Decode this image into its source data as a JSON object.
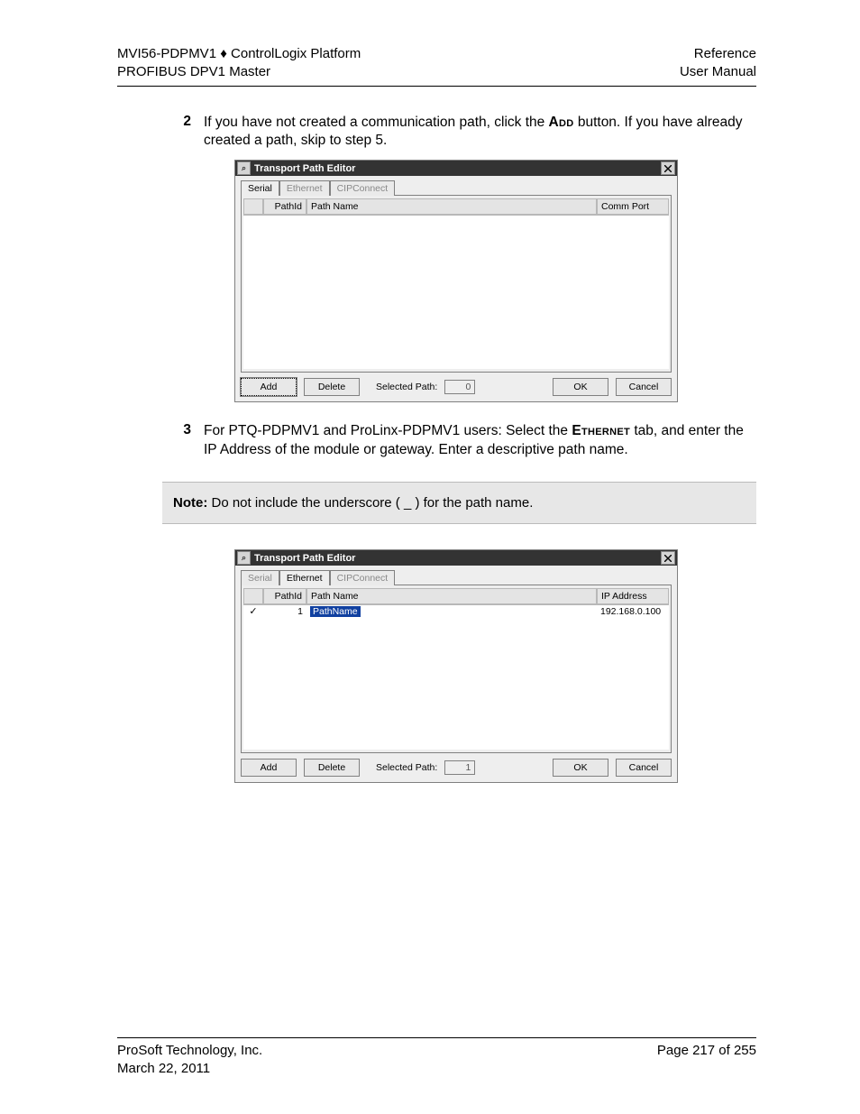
{
  "header": {
    "left_line1": "MVI56-PDPMV1 ♦ ControlLogix Platform",
    "left_line2": "PROFIBUS DPV1 Master",
    "right_line1": "Reference",
    "right_line2": "User Manual"
  },
  "step2": {
    "num": "2",
    "pre": "If you have not created a communication path, click the ",
    "bold": "Add",
    "post": " button. If you have already created a path, skip to step 5."
  },
  "step3": {
    "num": "3",
    "pre": "For PTQ-PDPMV1 and ProLinx-PDPMV1 users: Select the ",
    "bold": "Ethernet",
    "post": " tab, and enter the IP Address of the module or gateway. Enter a descriptive path name."
  },
  "note": {
    "label": "Note:",
    "text": " Do not include the underscore ( _ ) for the path name."
  },
  "dialog1": {
    "title": "Transport Path Editor",
    "tabs": {
      "serial": "Serial",
      "ethernet": "Ethernet",
      "cip": "CIPConnect"
    },
    "active_tab": "serial",
    "columns": {
      "chk": "",
      "id": "PathId",
      "name": "Path Name",
      "port": "Comm Port"
    },
    "rows": [],
    "footer": {
      "add": "Add",
      "delete": "Delete",
      "sel_label": "Selected Path:",
      "sel_value": "0",
      "ok": "OK",
      "cancel": "Cancel"
    }
  },
  "dialog2": {
    "title": "Transport Path Editor",
    "tabs": {
      "serial": "Serial",
      "ethernet": "Ethernet",
      "cip": "CIPConnect"
    },
    "active_tab": "ethernet",
    "columns": {
      "chk": "",
      "id": "PathId",
      "name": "Path Name",
      "port": "IP Address"
    },
    "rows": [
      {
        "check": "✓",
        "id": "1",
        "name": "PathName",
        "port": "192.168.0.100"
      }
    ],
    "footer": {
      "add": "Add",
      "delete": "Delete",
      "sel_label": "Selected Path:",
      "sel_value": "1",
      "ok": "OK",
      "cancel": "Cancel"
    }
  },
  "footer": {
    "left_line1": "ProSoft Technology, Inc.",
    "left_line2": "March 22, 2011",
    "right_line1": "Page 217 of 255"
  }
}
